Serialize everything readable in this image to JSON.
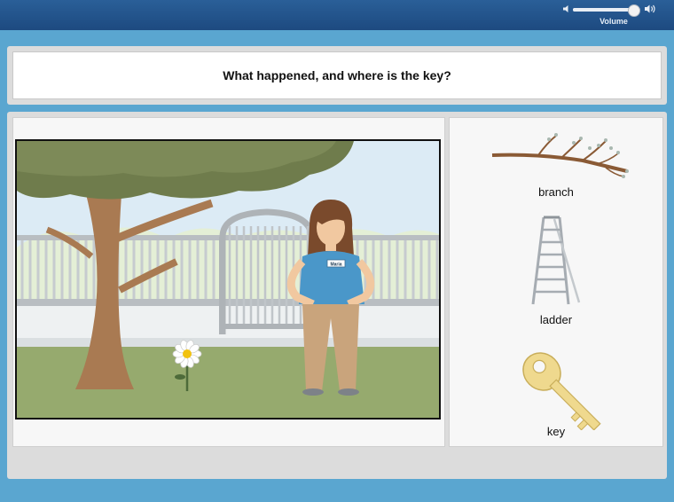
{
  "header": {
    "volume_label": "Volume",
    "volume_level": 0.9,
    "icons": [
      "speaker-low-icon",
      "speaker-high-icon"
    ]
  },
  "question": {
    "text": "What happened, and where is the key?"
  },
  "scene": {
    "badge_text": "Maria"
  },
  "words": [
    {
      "label": "branch",
      "icon": "branch-icon"
    },
    {
      "label": "ladder",
      "icon": "ladder-icon"
    },
    {
      "label": "key",
      "icon": "key-icon"
    }
  ],
  "colors": {
    "top_bar": "#1d4a80",
    "background": "#5aa6d0",
    "panel": "#dcdcdc"
  }
}
